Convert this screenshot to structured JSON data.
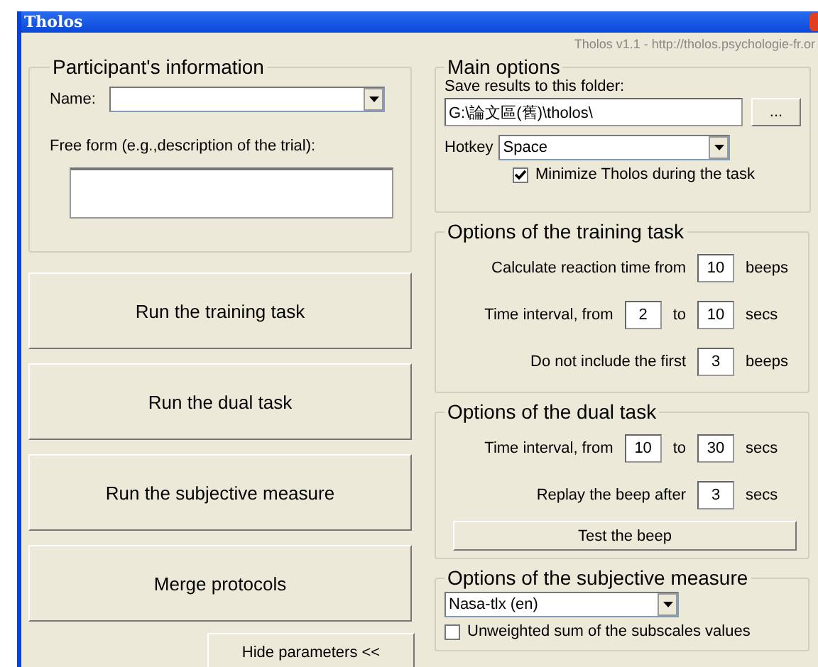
{
  "window": {
    "title": "Tholos",
    "version": "Tholos v1.1 - http://tholos.psychologie-fr.or"
  },
  "participant": {
    "title": "Participant's information",
    "name_label": "Name:",
    "free_form_label": "Free form (e.g.,description of the trial):"
  },
  "actions": [
    "Run the training task",
    "Run the dual task",
    "Run the subjective measure",
    "Merge protocols"
  ],
  "hide_button": "Hide parameters <<",
  "main_options": {
    "title": "Main options",
    "folder_label": "Save results to this folder:",
    "folder_value": "G:\\論文區(舊)\\tholos\\",
    "browse_button": "...",
    "hotkey_label": "Hotkey",
    "hotkey_value": "Space",
    "minimize": {
      "label": "Minimize Tholos during the task",
      "checked": true
    }
  },
  "training": {
    "title": "Options of the training task",
    "settings": [
      {
        "label": "Calculate reaction time from",
        "value": "10",
        "unit": "beeps"
      },
      {
        "label": "Time interval, from",
        "value": "2",
        "to_label": "to",
        "to_value": "10",
        "unit": "secs"
      },
      {
        "label": "Do not include the first",
        "value": "3",
        "unit": "beeps"
      }
    ]
  },
  "dual": {
    "title": "Options of the dual task",
    "settings": [
      {
        "label": "Time interval, from",
        "value": "10",
        "to_label": "to",
        "to_value": "30",
        "unit": "secs"
      },
      {
        "label": "Replay the beep after",
        "value": "3",
        "unit": "secs"
      }
    ],
    "test_button": "Test the beep"
  },
  "subjective": {
    "title": "Options of the subjective measure",
    "scale_value": "Nasa-tlx (en)",
    "unweighted": {
      "label": "Unweighted sum of the subscales values",
      "checked": false
    }
  }
}
